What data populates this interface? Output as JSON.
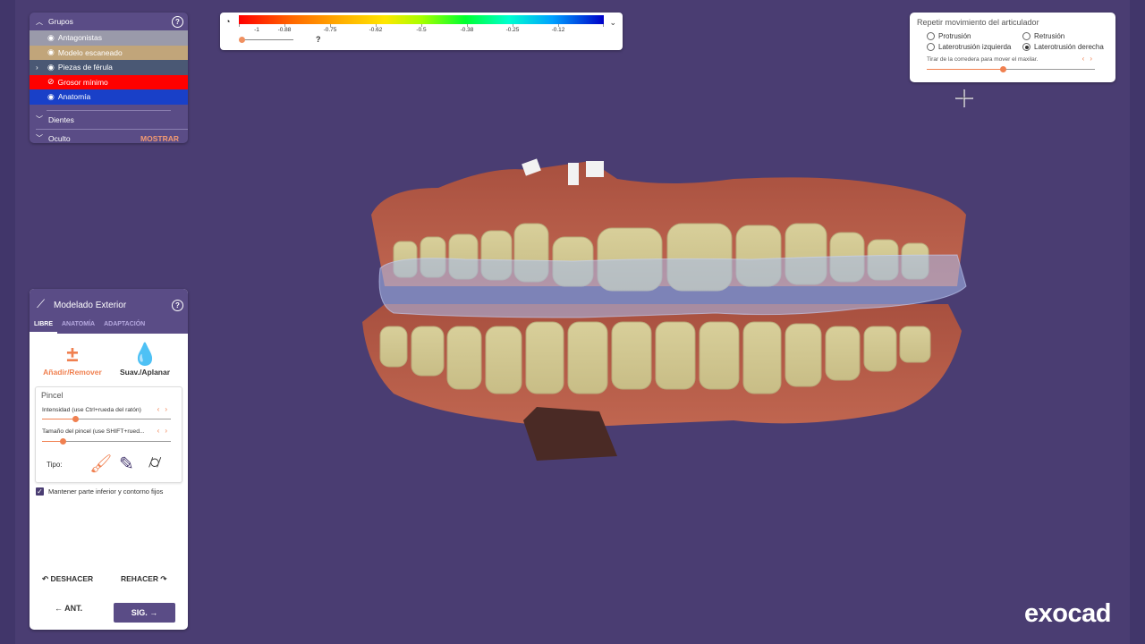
{
  "groups": {
    "title": "Grupos",
    "items": [
      {
        "label": "Antagonistas",
        "color": "#9a9aaa"
      },
      {
        "label": "Modelo escaneado",
        "color": "#c1a57a"
      },
      {
        "label": "Piezas de férula",
        "color": "#4a5874"
      },
      {
        "label": "Grosor mínimo",
        "color": "#ff0000"
      },
      {
        "label": "Anatomía",
        "color": "#1940c8"
      }
    ],
    "dientes": "Dientes",
    "oculto": "Oculto",
    "mostrar": "MOSTRAR"
  },
  "scale": {
    "values": [
      "-1",
      "-0.88",
      "-0.75",
      "-0.62",
      "-0.5",
      "-0.38",
      "-0.25",
      "-0.12"
    ],
    "question": "?"
  },
  "articulator": {
    "title": "Repetir movimiento del articulador",
    "options": [
      "Protrusión",
      "Retrusión",
      "Laterotrusión izquierda",
      "Laterotrusión derecha"
    ],
    "selected": "Laterotrusión derecha",
    "hint": "Tirar de la corredera para mover el maxilar.",
    "slider_value": 0.45
  },
  "modelado": {
    "title": "Modelado Exterior",
    "tabs": [
      "LIBRE",
      "ANATOMÍA",
      "ADAPTACIÓN"
    ],
    "active_tab": "LIBRE",
    "tool_add": "Añadir/Remover",
    "tool_smooth": "Suav./Aplanar",
    "pincel_title": "Pincel",
    "intensity_label": "Intensidad (use Ctrl+rueda del ratón)",
    "intensity_value": 0.26,
    "size_label": "Tamaño del pincel (use SHIFT+rued...",
    "size_value": 0.16,
    "tipo": "Tipo:",
    "keep_label": "Mantener parte inferior y contorno fijos",
    "keep_checked": true,
    "undo": "DESHACER",
    "redo": "REHACER",
    "prev": "ANT.",
    "next": "SIG."
  },
  "brand": "exocad"
}
